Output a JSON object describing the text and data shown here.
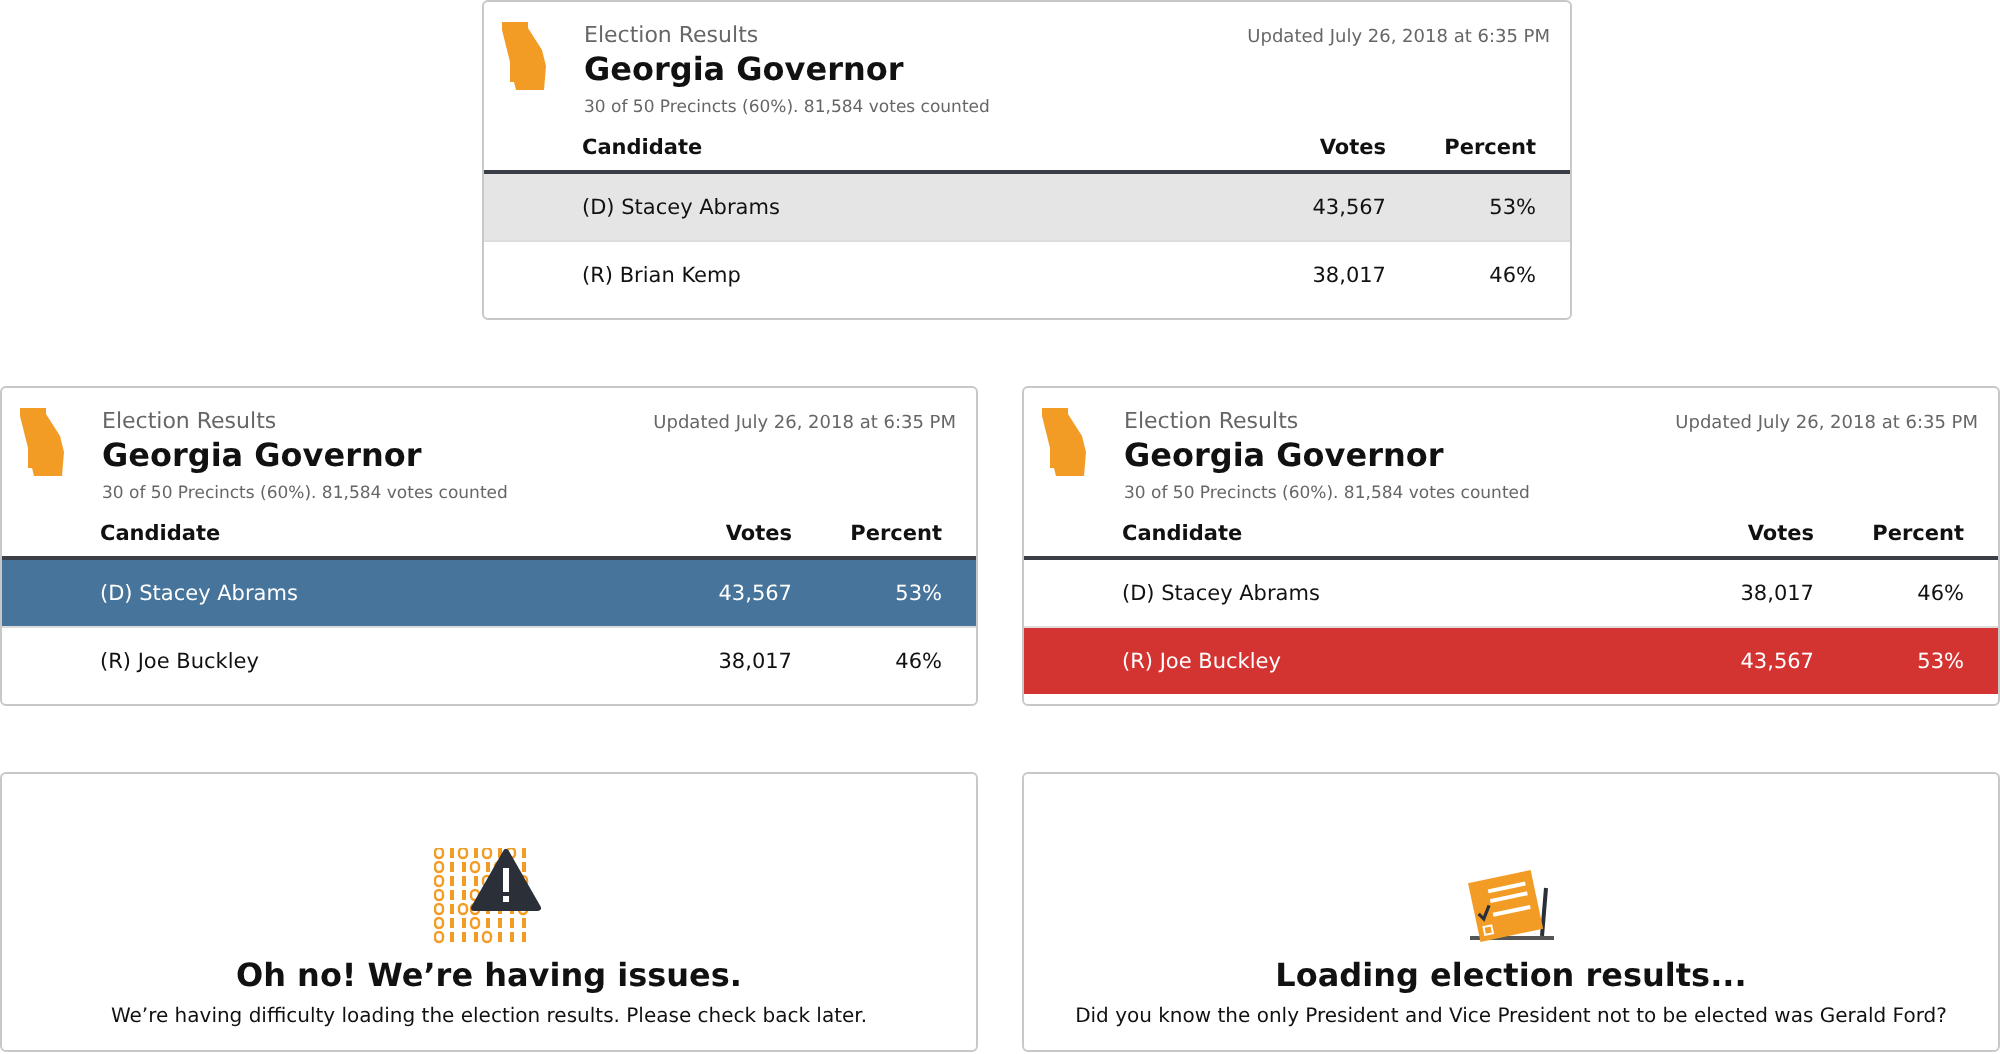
{
  "results_cards": [
    {
      "label": "Election Results",
      "title": "Georgia Governor",
      "updated": "Updated July 26, 2018 at 6:35 PM",
      "summary": "30 of 50 Precincts (60%). 81,584 votes counted",
      "columns": [
        "Candidate",
        "Votes",
        "Percent"
      ],
      "rows": [
        {
          "candidate": "(D) Stacey Abrams",
          "votes": "43,567",
          "percent": "53%",
          "selected": true,
          "color": "#e5e5e5"
        },
        {
          "candidate": "(R) Brian Kemp",
          "votes": "38,017",
          "percent": "46%",
          "selected": false
        }
      ]
    },
    {
      "label": "Election Results",
      "title": "Georgia Governor",
      "updated": "Updated July 26, 2018 at 6:35 PM",
      "summary": "30 of 50 Precincts (60%). 81,584 votes counted",
      "columns": [
        "Candidate",
        "Votes",
        "Percent"
      ],
      "rows": [
        {
          "candidate": "(D) Stacey Abrams",
          "votes": "43,567",
          "percent": "53%",
          "selected": true,
          "color": "#47749a"
        },
        {
          "candidate": "(R) Joe Buckley",
          "votes": "38,017",
          "percent": "46%",
          "selected": false
        }
      ]
    },
    {
      "label": "Election Results",
      "title": "Georgia Governor",
      "updated": "Updated July 26, 2018 at 6:35 PM",
      "summary": "30 of 50 Precincts (60%). 81,584 votes counted",
      "columns": [
        "Candidate",
        "Votes",
        "Percent"
      ],
      "rows": [
        {
          "candidate": "(D) Stacey Abrams",
          "votes": "38,017",
          "percent": "46%",
          "selected": false
        },
        {
          "candidate": "(R) Joe Buckley",
          "votes": "43,567",
          "percent": "53%",
          "selected": true,
          "color": "#d43431"
        }
      ]
    }
  ],
  "status_cards": [
    {
      "kind": "error",
      "heading": "Oh no! We’re having issues.",
      "message": "We’re having difficulty loading the election results. Please check back later."
    },
    {
      "kind": "loading",
      "heading": "Loading election results...",
      "message": "Did you know the only President and Vice President not to be elected was Gerald Ford?"
    }
  ]
}
